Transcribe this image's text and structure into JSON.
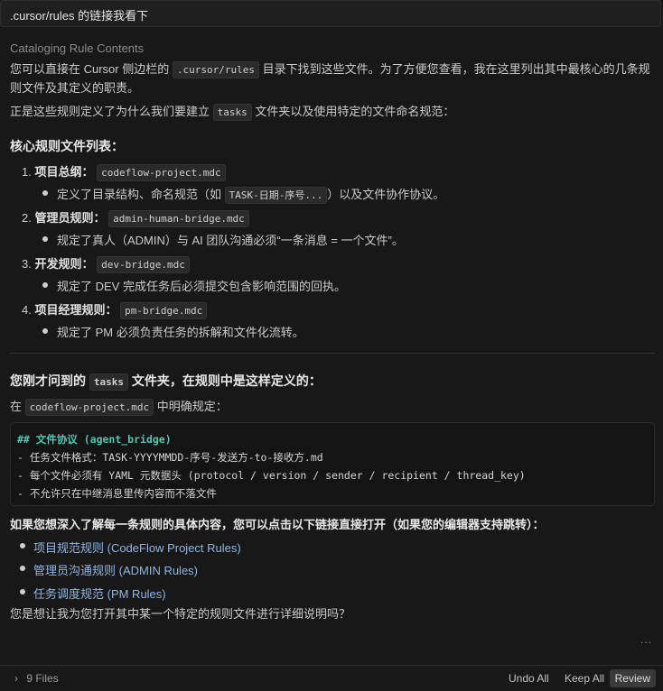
{
  "user_message": ".cursor/rules 的链接我看下",
  "thinking_label": "Cataloging Rule Contents",
  "intro": {
    "line1_a": "您可以直接在 Cursor 侧边栏的",
    "line1_code": ".cursor/rules",
    "line1_b": "目录下找到这些文件。为了方便您查看，我在这里列出其中最核心的几条规",
    "line2": "则文件及其定义的职责。",
    "line3_a": "正是这些规则定义了为什么我们要建立",
    "line3_code": "tasks",
    "line3_b": "文件夹以及使用特定的文件命名规范："
  },
  "core_heading": "核心规则文件列表：",
  "rules": [
    {
      "num": "1.",
      "title": "项目总纲：",
      "file": "codeflow-project.mdc",
      "desc_a": "定义了目录结构、命名规范（如",
      "desc_code": "TASK-日期-序号...",
      "desc_b": "）以及文件协作协议。"
    },
    {
      "num": "2.",
      "title": "管理员规则：",
      "file": "admin-human-bridge.mdc",
      "desc_a": "规定了真人（ADMIN）与 AI 团队沟通必须“一条消息 = 一个文件”。",
      "desc_code": "",
      "desc_b": ""
    },
    {
      "num": "3.",
      "title": "开发规则：",
      "file": "dev-bridge.mdc",
      "desc_a": "规定了 DEV 完成任务后必须提交包含影响范围的回执。",
      "desc_code": "",
      "desc_b": ""
    },
    {
      "num": "4.",
      "title": "项目经理规则：",
      "file": "pm-bridge.mdc",
      "desc_a": "规定了 PM 必须负责任务的拆解和文件化流转。",
      "desc_code": "",
      "desc_b": ""
    }
  ],
  "tasks_heading": {
    "a": "您刚才问到的",
    "code": "tasks",
    "b": "文件夹，在规则中是这样定义的："
  },
  "defined_in": {
    "a": "在",
    "code": "codeflow-project.mdc",
    "b": "中明确规定："
  },
  "codeblock": {
    "heading_hash": "##",
    "heading_text": "文件协议 (agent_bridge)",
    "lines": [
      "- 任务文件格式：TASK-YYYYMMDD-序号-发送方-to-接收方.md",
      "- 每个文件必须有 YAML 元数据头 (protocol / version / sender / recipient / thread_key)",
      "- 不允许只在中继消息里传内容而不落文件"
    ]
  },
  "links_intro": "如果您想深入了解每一条规则的具体内容，您可以点击以下链接直接打开（如果您的编辑器支持跳转）：",
  "links": [
    "项目规范规则 (CodeFlow Project Rules)",
    "管理员沟通规则 (ADMIN Rules)",
    "任务调度规范 (PM Rules)"
  ],
  "closing_question": "您是想让我为您打开其中某一个特定的规则文件进行详细说明吗？",
  "more_label": "...",
  "footer": {
    "files_label": "9 Files",
    "undo_all": "Undo All",
    "keep_all": "Keep All",
    "review": "Review"
  }
}
